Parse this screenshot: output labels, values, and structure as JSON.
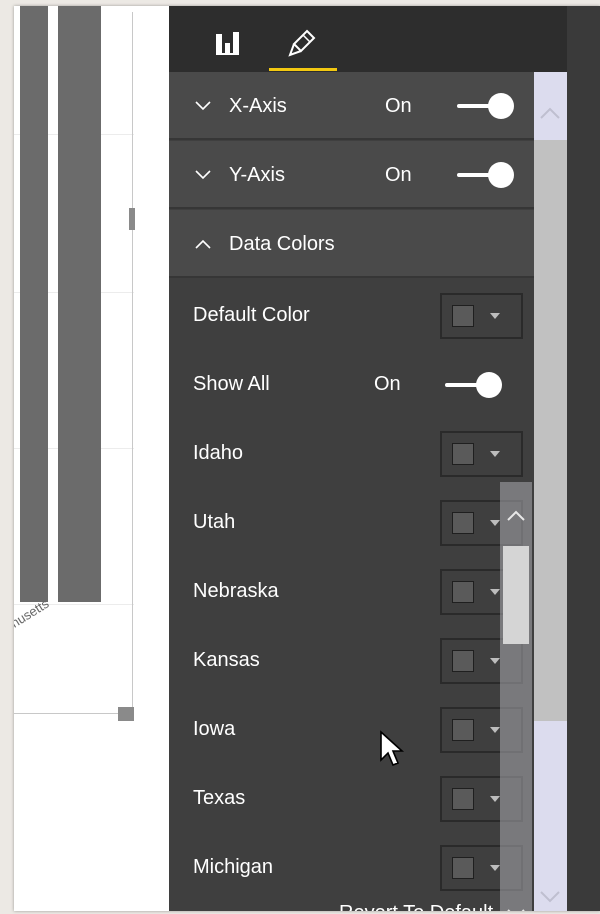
{
  "chart": {
    "axis_label_fragment": "husetts"
  },
  "pane": {
    "tabs": [
      {
        "name": "fields",
        "icon": "bar-chart-icon"
      },
      {
        "name": "format",
        "icon": "paint-roller-icon",
        "active": true
      }
    ],
    "sections": [
      {
        "title": "X-Axis",
        "expanded": false,
        "state": "On",
        "toggle_on": true
      },
      {
        "title": "Y-Axis",
        "expanded": false,
        "state": "On",
        "toggle_on": true
      },
      {
        "title": "Data Colors",
        "expanded": true
      }
    ],
    "default_color_label": "Default Color",
    "show_all": {
      "label": "Show All",
      "state": "On",
      "toggle_on": true
    },
    "states": [
      "Idaho",
      "Utah",
      "Nebraska",
      "Kansas",
      "Iowa",
      "Texas",
      "Michigan"
    ],
    "reset_label": "Revert To Default"
  },
  "colors": {
    "accent": "#f2c811",
    "pane_bg": "#3f3f3f",
    "section_bg": "#4a4a4a",
    "bar": "#6b6b6b"
  }
}
